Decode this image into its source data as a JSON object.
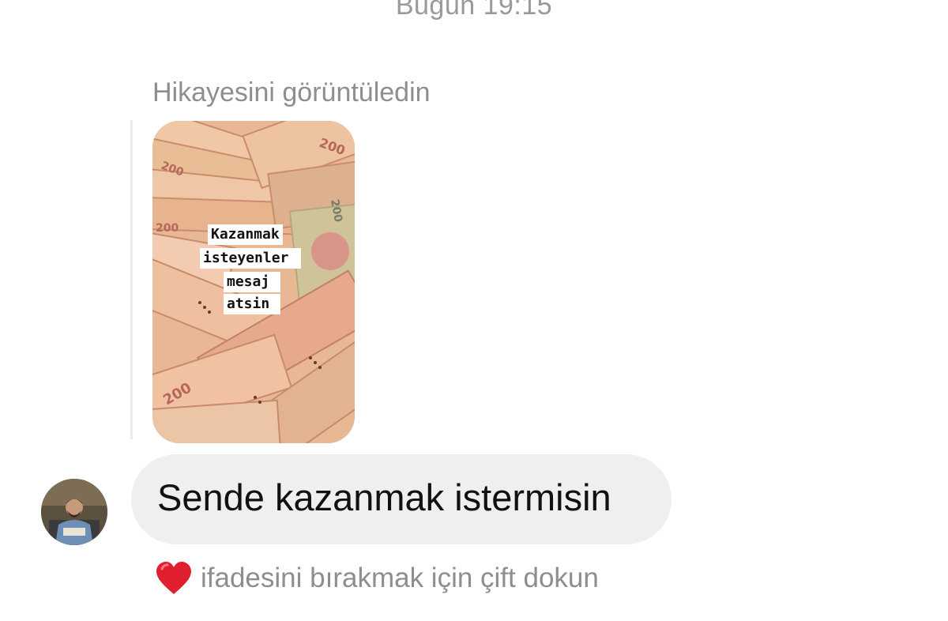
{
  "conversation": {
    "timestamp": "Bugün 19:15"
  },
  "story_reply": {
    "label": "Hikayesini görüntüledin",
    "caption_lines": [
      "Kazanmak",
      "isteyenler",
      "mesaj",
      "atsin"
    ],
    "bill_denomination": "200",
    "thumbnail_colors": [
      "#e8b894",
      "#f0c8a8",
      "#d99a7a",
      "#cfc39a",
      "#e7a98c"
    ]
  },
  "message": {
    "text": "Sende kazanmak istermisin",
    "bubble_color": "#efefef"
  },
  "reaction_hint": {
    "icon": "heart-icon",
    "text": "ifadesini bırakmak için çift dokun",
    "heart_color": "#e0202e"
  }
}
